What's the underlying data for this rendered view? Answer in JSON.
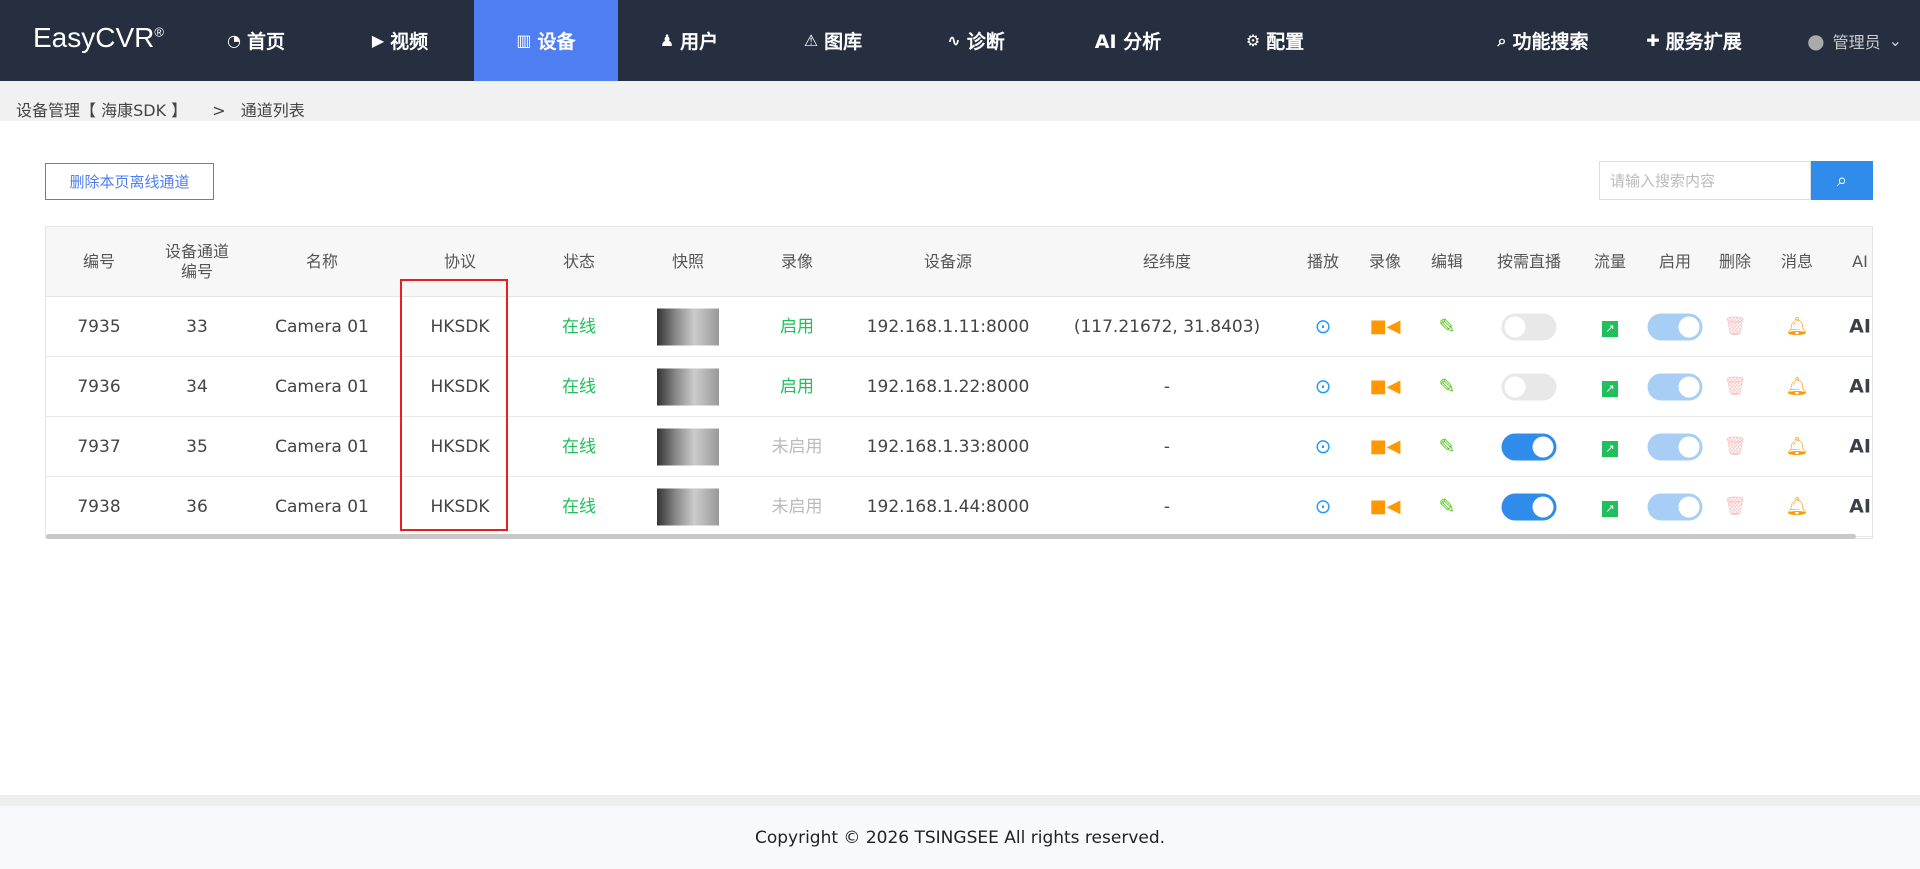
{
  "nav": {
    "logo": "EasyCVR",
    "logo_mark": "®",
    "items": [
      {
        "label": "首页",
        "icon": "dashboard-icon"
      },
      {
        "label": "视频",
        "icon": "play-circle-icon"
      },
      {
        "label": "设备",
        "icon": "device-icon"
      },
      {
        "label": "用户",
        "icon": "user-icon"
      },
      {
        "label": "图库",
        "icon": "alarm-icon"
      },
      {
        "label": "诊断",
        "icon": "pulse-icon"
      },
      {
        "label": "AI 分析",
        "icon": ""
      },
      {
        "label": "配置",
        "icon": "gear-icon"
      },
      {
        "label": "功能搜索",
        "icon": "search-icon"
      },
      {
        "label": "服务扩展",
        "icon": "puzzle-icon"
      }
    ],
    "active": "设备",
    "user": "管理员"
  },
  "breadcrumb": {
    "parent": "设备管理【 海康SDK 】",
    "sep": ">",
    "current": "通道列表"
  },
  "toolbar": {
    "delete_offline": "删除本页离线通道",
    "search_placeholder": "请输入搜索内容"
  },
  "table": {
    "headers": [
      "编号",
      "设备通道\n编号",
      "名称",
      "协议",
      "状态",
      "快照",
      "录像",
      "设备源",
      "经纬度",
      "播放",
      "录像",
      "编辑",
      "按需直播",
      "流量",
      "启用",
      "删除",
      "消息",
      "AI"
    ],
    "rows": [
      {
        "id": "7935",
        "channel": "33",
        "name": "Camera 01",
        "protocol": "HKSDK",
        "status": "在线",
        "record": "启用",
        "record_on": true,
        "source": "192.168.1.11:8000",
        "geo": "(117.21672, 31.8403)",
        "on_demand": false,
        "enabled": true,
        "ai": "AI"
      },
      {
        "id": "7936",
        "channel": "34",
        "name": "Camera 01",
        "protocol": "HKSDK",
        "status": "在线",
        "record": "启用",
        "record_on": true,
        "source": "192.168.1.22:8000",
        "geo": "-",
        "on_demand": false,
        "enabled": true,
        "ai": "AI"
      },
      {
        "id": "7937",
        "channel": "35",
        "name": "Camera 01",
        "protocol": "HKSDK",
        "status": "在线",
        "record": "未启用",
        "record_on": false,
        "source": "192.168.1.33:8000",
        "geo": "-",
        "on_demand": true,
        "enabled": true,
        "ai": "AI"
      },
      {
        "id": "7938",
        "channel": "36",
        "name": "Camera 01",
        "protocol": "HKSDK",
        "status": "在线",
        "record": "未启用",
        "record_on": false,
        "source": "192.168.1.44:8000",
        "geo": "-",
        "on_demand": true,
        "enabled": true,
        "ai": "AI"
      }
    ]
  },
  "colors": {
    "nav_bg": "#262f3f",
    "accent": "#4f7ef2",
    "online": "#1fbf5b",
    "highlight_box": "#e81f1f"
  },
  "footer": "Copyright © 2026 TSINGSEE All rights reserved."
}
